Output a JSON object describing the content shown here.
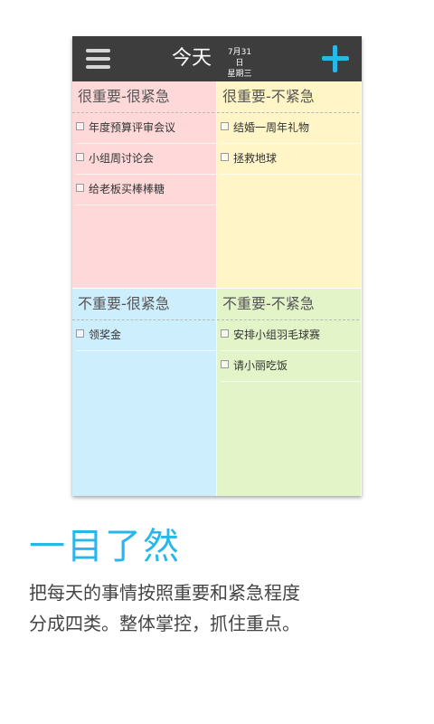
{
  "header": {
    "title": "今天",
    "date_line1": "7月31日",
    "date_line2": "星期三"
  },
  "quadrants": {
    "q1": {
      "title": "很重要-很紧急",
      "tasks": [
        "年度预算评审会议",
        "小组周讨论会",
        "给老板买棒棒糖"
      ]
    },
    "q2": {
      "title": "很重要-不紧急",
      "tasks": [
        "结婚一周年礼物",
        "拯救地球"
      ]
    },
    "q3": {
      "title": "不重要-很紧急",
      "tasks": [
        "领奖金"
      ]
    },
    "q4": {
      "title": "不重要-不紧急",
      "tasks": [
        "安排小组羽毛球赛",
        "请小丽吃饭"
      ]
    }
  },
  "promo": {
    "headline": "一目了然",
    "line1": "把每天的事情按照重要和紧急程度",
    "line2": "分成四类。整体掌控，抓住重点。"
  },
  "icons": {
    "menu": "hamburger-menu-icon",
    "add": "plus-icon"
  },
  "colors": {
    "accent": "#29b6ea",
    "topbar": "#3d3d3d",
    "q1": "#ffd9d9",
    "q2": "#fff5c7",
    "q3": "#cdeefd",
    "q4": "#e3f5c8"
  }
}
